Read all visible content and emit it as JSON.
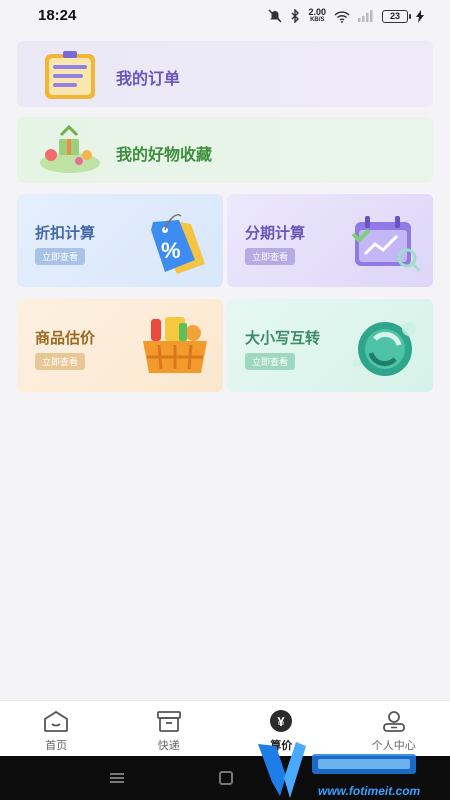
{
  "status_bar": {
    "time": "18:24",
    "net_speed_value": "2.00",
    "net_speed_unit": "KB/S",
    "battery_level": "23",
    "icons": [
      "mute-icon",
      "bluetooth-icon",
      "net-speed",
      "wifi-icon",
      "signal-icon",
      "battery-icon",
      "charging-icon"
    ]
  },
  "banners": {
    "orders": {
      "label": "我的订单",
      "icon": "clipboard-icon"
    },
    "favorites": {
      "label": "我的好物收藏",
      "icon": "gift-basket-icon"
    }
  },
  "tools": [
    {
      "title": "折扣计算",
      "action": "立即查看",
      "icon": "discount-tag-icon"
    },
    {
      "title": "分期计算",
      "action": "立即查看",
      "icon": "calendar-chart-icon"
    },
    {
      "title": "商品估价",
      "action": "立即查看",
      "icon": "shopping-basket-icon"
    },
    {
      "title": "大小写互转",
      "action": "立即查看",
      "icon": "coin-convert-icon"
    }
  ],
  "bottom_nav": {
    "items": [
      {
        "label": "首页",
        "icon": "home-icon",
        "active": false
      },
      {
        "label": "快递",
        "icon": "box-icon",
        "active": false
      },
      {
        "label": "算价",
        "icon": "yen-icon",
        "active": true
      },
      {
        "label": "个人中心",
        "icon": "user-icon",
        "active": false
      }
    ]
  },
  "watermark": {
    "url": "www.fotimeit.com"
  },
  "colors": {
    "accent_purple": "#6a55c0",
    "accent_green": "#3e8e3e",
    "page_bg": "#f4f4f6"
  }
}
